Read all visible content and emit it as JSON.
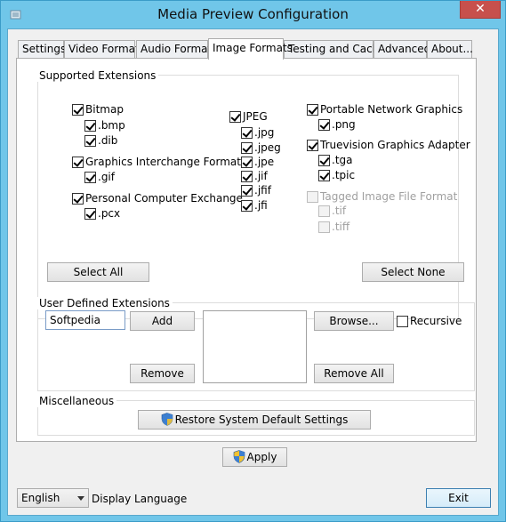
{
  "window": {
    "title": "Media Preview Configuration",
    "close_glyph": "✕",
    "app_icon": "app-icon",
    "accent_color": "#70c6e9",
    "close_color": "#c7504c"
  },
  "tabs": [
    {
      "label": "Settings",
      "active": false
    },
    {
      "label": "Video Formats",
      "active": false
    },
    {
      "label": "Audio Formats",
      "active": false
    },
    {
      "label": "Image Formats",
      "active": true
    },
    {
      "label": "Testing and Cache",
      "active": false
    },
    {
      "label": "Advanced",
      "active": false
    },
    {
      "label": "About...",
      "active": false
    }
  ],
  "supported": {
    "group_label": "Supported Extensions",
    "bitmap": {
      "label": "Bitmap",
      "checked": true,
      "exts": [
        {
          "label": ".bmp",
          "checked": true
        },
        {
          "label": ".dib",
          "checked": true
        }
      ]
    },
    "gif": {
      "label": "Graphics Interchange Format",
      "checked": true,
      "exts": [
        {
          "label": ".gif",
          "checked": true
        }
      ]
    },
    "pcx": {
      "label": "Personal Computer Exchange",
      "checked": true,
      "exts": [
        {
          "label": ".pcx",
          "checked": true
        }
      ]
    },
    "jpeg": {
      "label": "JPEG",
      "checked": true,
      "exts": [
        {
          "label": ".jpg",
          "checked": true
        },
        {
          "label": ".jpeg",
          "checked": true
        },
        {
          "label": ".jpe",
          "checked": true
        },
        {
          "label": ".jif",
          "checked": true
        },
        {
          "label": ".jfif",
          "checked": true
        },
        {
          "label": ".jfi",
          "checked": true
        }
      ]
    },
    "png": {
      "label": "Portable Network Graphics",
      "checked": true,
      "exts": [
        {
          "label": ".png",
          "checked": true
        }
      ]
    },
    "tga": {
      "label": "Truevision Graphics Adapter",
      "checked": true,
      "exts": [
        {
          "label": ".tga",
          "checked": true
        },
        {
          "label": ".tpic",
          "checked": true
        }
      ]
    },
    "tiff": {
      "label": "Tagged Image File Format",
      "checked": false,
      "disabled": true,
      "exts": [
        {
          "label": ".tif",
          "checked": false
        },
        {
          "label": ".tiff",
          "checked": false
        }
      ]
    },
    "select_all_label": "Select All",
    "select_none_label": "Select None"
  },
  "user_defined": {
    "group_label": "User Defined Extensions",
    "input_value": "Softpedia",
    "add_label": "Add",
    "remove_label": "Remove",
    "list_items": [],
    "browse_label": "Browse...",
    "recursive_label": "Recursive",
    "recursive_checked": false,
    "remove_all_label": "Remove All"
  },
  "misc": {
    "group_label": "Miscellaneous",
    "restore_label": "Restore System Default Settings",
    "restore_icon": "shield-icon"
  },
  "apply": {
    "label": "Apply",
    "icon": "shield-icon"
  },
  "footer": {
    "language_value": "English",
    "language_label": "Display Language",
    "exit_label": "Exit"
  }
}
